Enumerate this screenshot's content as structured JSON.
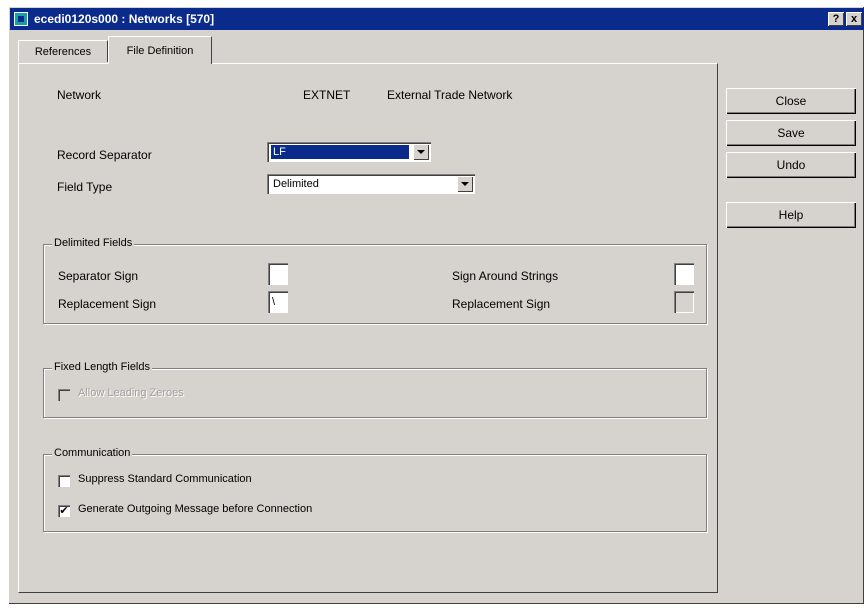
{
  "window": {
    "title": "ecedi0120s000 : Networks [570]",
    "help_btn": "?",
    "close_btn": "x"
  },
  "tabs": [
    {
      "label": "References",
      "active": false
    },
    {
      "label": "File Definition",
      "active": true
    }
  ],
  "network": {
    "label": "Network",
    "code": "EXTNET",
    "description": "External Trade Network"
  },
  "record_separator": {
    "label": "Record Separator",
    "value": "LF"
  },
  "field_type": {
    "label": "Field Type",
    "value": "Delimited"
  },
  "delimited_fields": {
    "title": "Delimited Fields",
    "separator_sign": {
      "label": "Separator Sign",
      "value": ""
    },
    "replacement_sign_left": {
      "label": "Replacement Sign",
      "value": "\\"
    },
    "sign_around_strings": {
      "label": "Sign Around Strings",
      "value": ""
    },
    "replacement_sign_right": {
      "label": "Replacement Sign",
      "value": ""
    }
  },
  "fixed_length_fields": {
    "title": "Fixed Length Fields",
    "allow_leading_zeroes": {
      "label": "Allow Leading Zeroes",
      "checked": false,
      "disabled": true
    }
  },
  "communication": {
    "title": "Communication",
    "suppress_standard": {
      "label": "Suppress Standard Communication",
      "checked": false
    },
    "generate_outgoing": {
      "label": "Generate Outgoing Message before Connection",
      "checked": true,
      "mark": "✔"
    }
  },
  "buttons": {
    "close": "Close",
    "save": "Save",
    "undo": "Undo",
    "help": "Help"
  }
}
